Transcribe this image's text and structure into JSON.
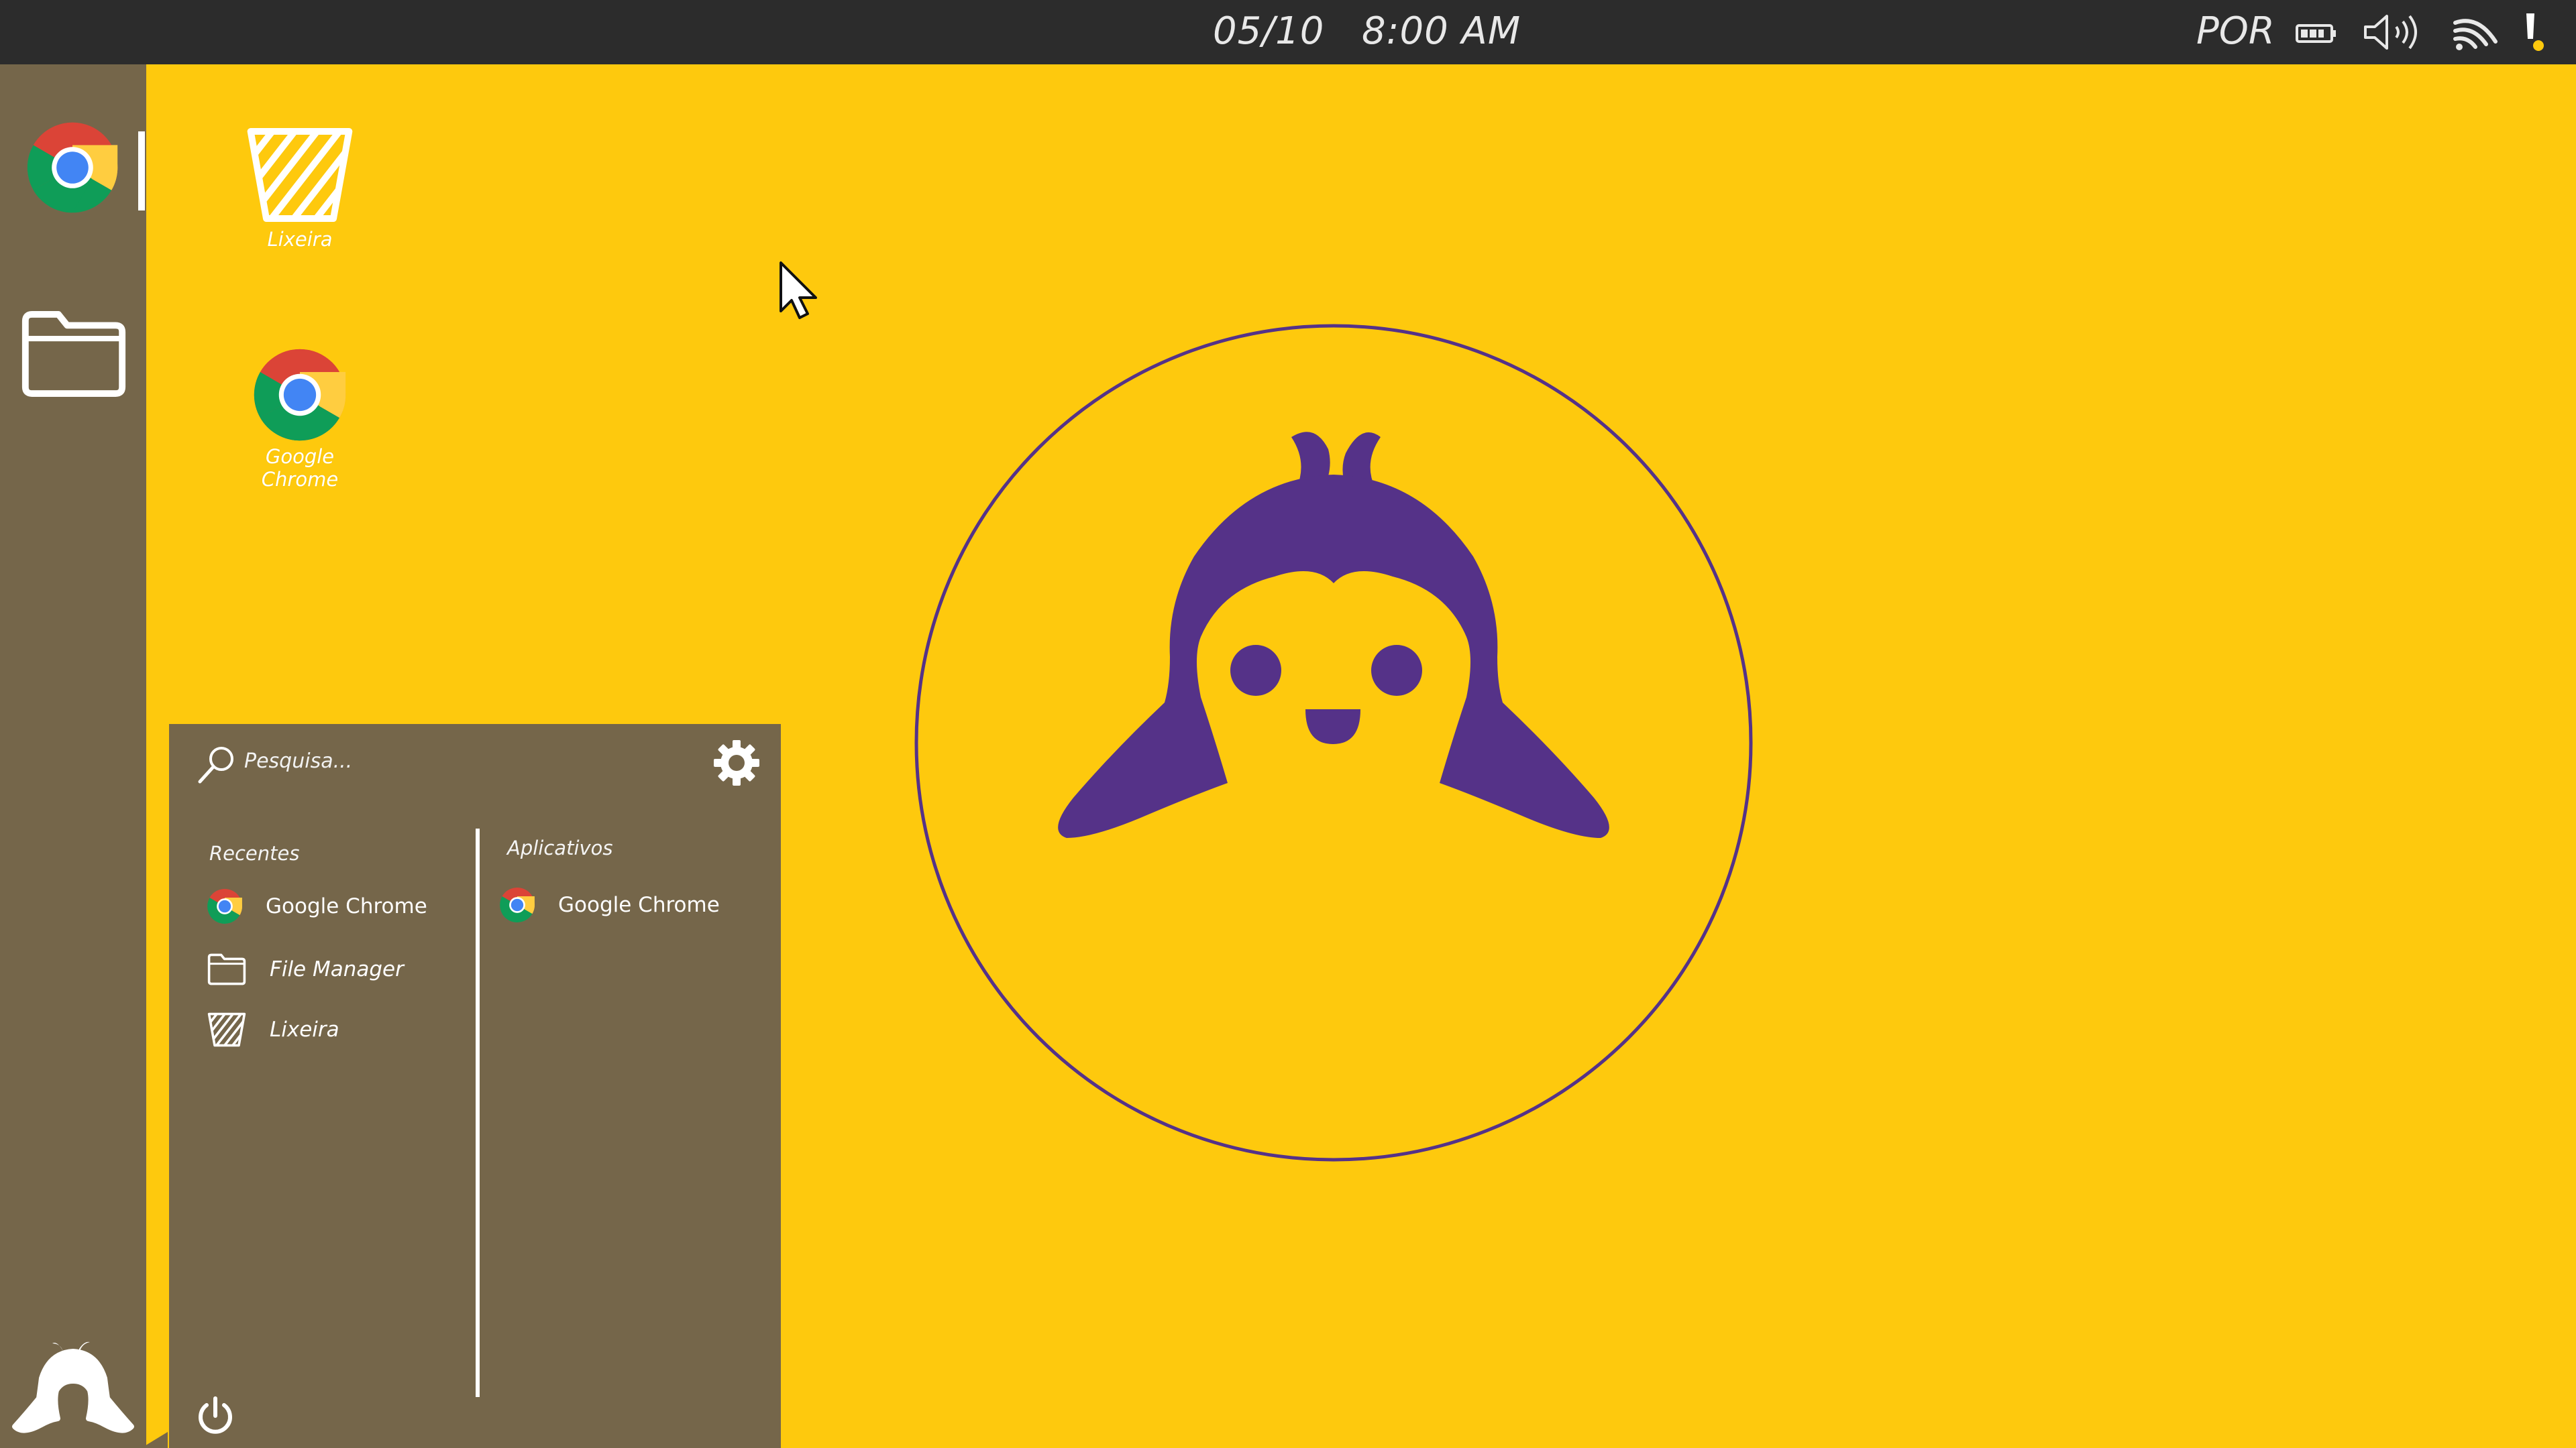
{
  "topbar": {
    "date": "05/10",
    "time": "8:00 AM",
    "language": "POR",
    "tray_icons": [
      "battery-icon",
      "volume-icon",
      "wifi-icon",
      "notification-alert-icon"
    ]
  },
  "dock": {
    "items": [
      {
        "name": "Google Chrome",
        "icon": "chrome-icon",
        "active": true
      },
      {
        "name": "File Manager",
        "icon": "folder-icon",
        "active": false
      }
    ],
    "launcher_icon": "penguin-logo-icon"
  },
  "desktop": {
    "icons": [
      {
        "label": "Lixeira",
        "icon": "trash-icon"
      },
      {
        "label_line1": "Google",
        "label_line2": "Chrome",
        "icon": "chrome-icon"
      }
    ]
  },
  "launcher": {
    "search_placeholder": "Pesquisa...",
    "recent_title": "Recentes",
    "recent": [
      {
        "label": "Google Chrome",
        "icon": "chrome-icon"
      },
      {
        "label": "File Manager",
        "icon": "folder-icon"
      },
      {
        "label": "Lixeira",
        "icon": "trash-icon"
      }
    ],
    "apps_title": "Aplicativos",
    "apps": [
      {
        "label": "Google Chrome",
        "icon": "chrome-icon"
      }
    ]
  },
  "colors": {
    "wallpaper": "#fec90d",
    "panel": "#75664a",
    "topbar": "#2c2c2c",
    "logo_purple": "#553288"
  }
}
